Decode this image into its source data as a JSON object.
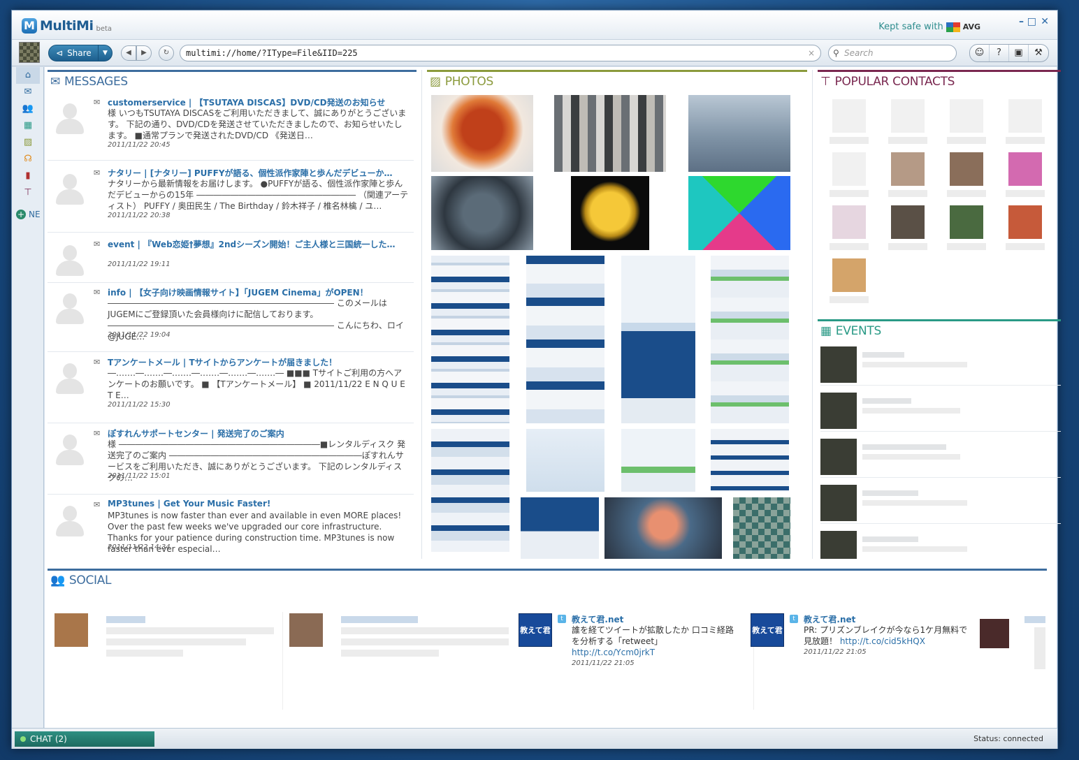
{
  "app": {
    "name": "MultiMi",
    "beta": "beta",
    "kept_safe": "Kept safe with",
    "avg": "AVG"
  },
  "toolbar": {
    "share_label": "Share",
    "address": "multimi://home/?IType=File&IID=225",
    "search_placeholder": "Search"
  },
  "sidebar": {
    "new_label": "NE"
  },
  "messages": {
    "header": "MESSAGES",
    "items": [
      {
        "title": "customerservice | 【TSUTAYA DISCAS】DVD/CD発送のお知らせ",
        "body": "様 いつもTSUTAYA DISCASをご利用いただきまして、誠にありがとうございます。 下記の通り、DVD/CDを発送させていただきましたので、お知らせいたします。 ■通常プランで発送されたDVD/CD 《発送日…",
        "date": "2011/11/22 20:45"
      },
      {
        "title": "ナタリー | [ナタリー] PUFFYが語る、個性派作家陣と歩んだデビューか…",
        "body": "ナタリーから最新情報をお届けします。 ●PUFFYが語る、個性派作家陣と歩んだデビューからの15年 ――――――――――――――――――― （関連アーティスト） PUFFY / 奥田民生 / The Birthday / 鈴木祥子 / 椎名林檎 / ユ…",
        "date": "2011/11/22 20:38"
      },
      {
        "title": "event | 『Web恋姫†夢想』2ndシーズン開始！ご主人様と三国統一した…",
        "body": "",
        "date": "2011/11/22 19:11"
      },
      {
        "title": "info | 【女子向け映画情報サイト】「JUGEM Cinema」がOPEN！",
        "body": "――――――――――――――――――――――――――― このメールはJUGEMにご登録頂いた会員様向けに配信しております。 ――――――――――――――――――――――――――― こんにちわ、ロイ@JUGE…",
        "date": "2011/11/22 19:04"
      },
      {
        "title": "Tアンケートメール | Tサイトからアンケートが届きました！",
        "body": "―‥…‥―‥…‥―‥…‥―‥…‥―‥…‥―‥…‥― ■■■ Tサイトご利用の方へアンケートのお願いです。 ■ 【Tアンケートメール】 ■ 2011/11/22 E N Q U E T E…",
        "date": "2011/11/22 15:30"
      },
      {
        "title": "ぽすれんサポートセンター | 発送完了のご案内",
        "body": "様 ――――――――――――――――――――――――■レンタルディスク 発送完了のご案内 ―――――――――――――――――――――――ぽすれんサービスをご利用いただき、誠にありがとうございます。 下記のレンタルディスクの…",
        "date": "2011/11/22 15:01"
      },
      {
        "title": "MP3tunes | Get Your Music Faster!",
        "body": "MP3tunes is now faster than ever and available in even MORE places! Over the past few weeks we've upgraded our core infrastructure. Thanks for your patience during construction time. MP3tunes is now faster than ever especial…",
        "date": "2011/11/22 14:34"
      }
    ]
  },
  "photos": {
    "header": "PHOTOS"
  },
  "contacts": {
    "header": "POPULAR CONTACTS"
  },
  "events": {
    "header": "EVENTS"
  },
  "social": {
    "header": "SOCIAL",
    "items": [
      {
        "name": "教えて君.net",
        "text": "誰を経てツイートが拡散したか 口コミ経路を分析する「retweet」 ",
        "link": "http://t.co/Ycm0jrkT",
        "date": "2011/11/22 21:05",
        "logo": "教えて君"
      },
      {
        "name": "教えて君.net",
        "text": "PR: プリズンブレイクが今なら1ケ月無料で見放題！ ",
        "link": "http://t.co/cid5kHQX",
        "date": "2011/11/22 21:05",
        "logo": "教えて君"
      }
    ]
  },
  "status": {
    "chat": "CHAT (2)",
    "connection": "Status: connected"
  },
  "colors": {
    "messages": "#3d6d9e",
    "photos": "#8b9a3c",
    "contacts": "#7a2850",
    "events": "#2a9a86",
    "social": "#3d6d9e"
  }
}
